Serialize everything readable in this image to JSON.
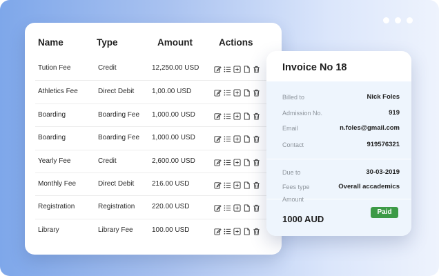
{
  "window": {
    "dots": [
      "dot",
      "dot",
      "dot"
    ]
  },
  "table": {
    "headers": {
      "name": "Name",
      "type": "Type",
      "amount": "Amount",
      "actions": "Actions"
    },
    "rows": [
      {
        "name": "Tution Fee",
        "type": "Credit",
        "amount": "12,250.00 USD"
      },
      {
        "name": "Athletics Fee",
        "type": "Direct Debit",
        "amount": "1,00.00 USD"
      },
      {
        "name": "Boarding",
        "type": "Boarding Fee",
        "amount": "1,000.00 USD"
      },
      {
        "name": "Boarding",
        "type": "Boarding Fee",
        "amount": "1,000.00 USD"
      },
      {
        "name": "Yearly Fee",
        "type": "Credit",
        "amount": "2,600.00 USD"
      },
      {
        "name": "Monthly Fee",
        "type": "Direct Debit",
        "amount": "216.00 USD"
      },
      {
        "name": "Registration",
        "type": "Registration",
        "amount": "220.00 USD"
      },
      {
        "name": "Library",
        "type": "Library Fee",
        "amount": "100.00 USD"
      }
    ],
    "action_icons": [
      "edit-icon",
      "list-icon",
      "add-icon",
      "document-icon",
      "trash-icon"
    ]
  },
  "invoice": {
    "title": "Invoice No 18",
    "billed_to_label": "Billed to",
    "billed_to": "Nick Foles",
    "admission_label": "Admission No.",
    "admission": "919",
    "email_label": "Email",
    "email": "n.foles@gmail.com",
    "contact_label": "Contact",
    "contact": "919576321",
    "due_label": "Due to",
    "due": "30-03-2019",
    "fees_type_label": "Fees type",
    "fees_type": "Overall accademics",
    "amount_label": "Amount",
    "amount": "1000 AUD",
    "status": "Paid"
  },
  "colors": {
    "accent_green": "#3c9a47",
    "background_gradient_start": "#7ea7ea",
    "invoice_panel": "#eef5fd"
  }
}
